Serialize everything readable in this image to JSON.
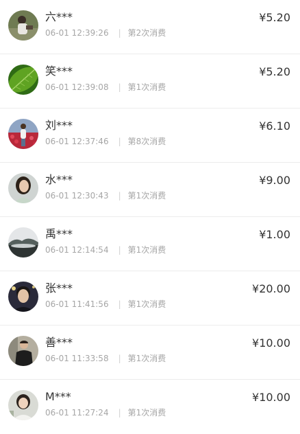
{
  "records": [
    {
      "name": "六***",
      "time": "06-01 12:39:26",
      "count_label": "第2次消费",
      "amount": "¥5.20",
      "avatar": "avatar-man-outdoors"
    },
    {
      "name": "笑***",
      "time": "06-01 12:39:08",
      "count_label": "第1次消费",
      "amount": "¥5.20",
      "avatar": "avatar-green-leaf"
    },
    {
      "name": "刘***",
      "time": "06-01 12:37:46",
      "count_label": "第8次消费",
      "amount": "¥6.10",
      "avatar": "avatar-flower-field"
    },
    {
      "name": "水***",
      "time": "06-01 12:30:43",
      "count_label": "第1次消费",
      "amount": "¥9.00",
      "avatar": "avatar-woman-portrait"
    },
    {
      "name": "禹***",
      "time": "06-01 12:14:54",
      "count_label": "第1次消费",
      "amount": "¥1.00",
      "avatar": "avatar-misty-landscape"
    },
    {
      "name": "张***",
      "time": "06-01 11:41:56",
      "count_label": "第1次消费",
      "amount": "¥20.00",
      "avatar": "avatar-young-man"
    },
    {
      "name": "善***",
      "time": "06-01 11:33:58",
      "count_label": "第1次消费",
      "amount": "¥10.00",
      "avatar": "avatar-man-dark-shirt"
    },
    {
      "name": "M***",
      "time": "06-01 11:27:24",
      "count_label": "第1次消费",
      "amount": "¥10.00",
      "avatar": "avatar-woman-light"
    }
  ],
  "separator": "|"
}
